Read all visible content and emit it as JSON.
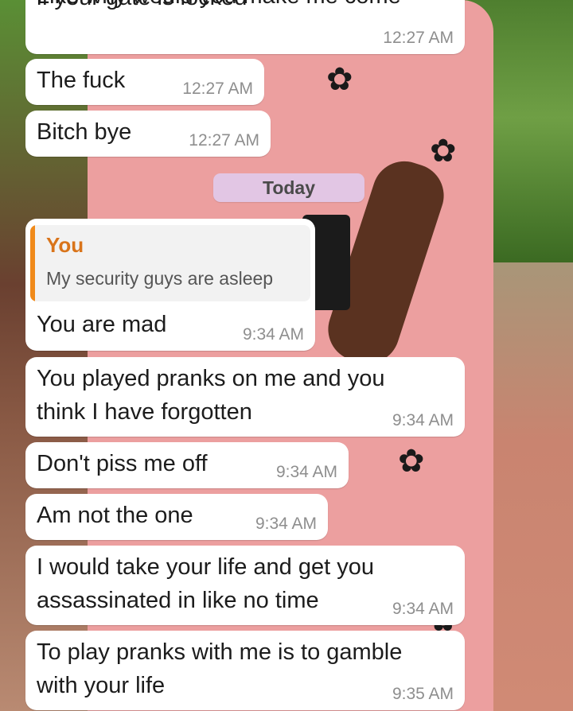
{
  "messages": [
    {
      "text": "Like why would you make me come",
      "time": ""
    },
    {
      "text": "if your gate is locked",
      "time": "12:27 AM"
    },
    {
      "text": "The fuck",
      "time": "12:27 AM"
    },
    {
      "text": "Bitch bye",
      "time": "12:27 AM"
    },
    {
      "text": "You are mad",
      "time": "9:34 AM",
      "reply_to": {
        "author": "You",
        "text": "My security guys are asleep"
      }
    },
    {
      "line1": "You played pranks on me and you",
      "line2": "think I have forgotten",
      "time": "9:34 AM"
    },
    {
      "text": "Don't piss me off",
      "time": "9:34 AM"
    },
    {
      "text": "Am not the one",
      "time": "9:34 AM"
    },
    {
      "line1": "I would take your life and get you",
      "line2": "assassinated in like no time",
      "time": "9:34 AM"
    },
    {
      "line1": "To play pranks with me is to gamble",
      "line2": "with your life",
      "time": "9:35 AM"
    }
  ],
  "date_divider": "Today",
  "colors": {
    "bubble": "#ffffff",
    "timestamp": "#8e8e8e",
    "reply_accent": "#f08a1a",
    "reply_author": "#d9741a",
    "date_pill": "#e2c6e4"
  }
}
